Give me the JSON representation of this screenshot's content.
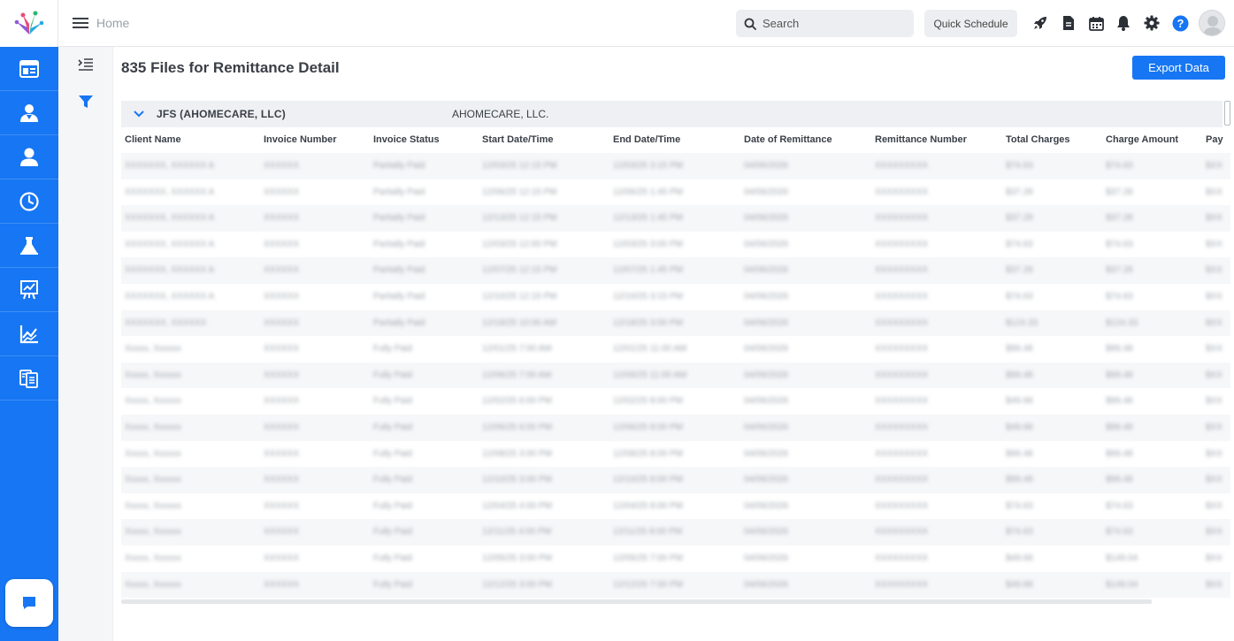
{
  "header": {
    "breadcrumb": "Home",
    "search_placeholder": "Search",
    "quick_schedule_label": "Quick Schedule"
  },
  "page": {
    "title": "835 Files for Remittance Detail",
    "export_label": "Export Data"
  },
  "group": {
    "name": "JFS (AHOMECARE, LLC)",
    "sub": "AHOMECARE, LLC."
  },
  "table": {
    "columns": [
      "Client Name",
      "Invoice Number",
      "Invoice Status",
      "Start Date/Time",
      "End Date/Time",
      "Date of Remittance",
      "Remittance Number",
      "Total Charges",
      "Charge Amount",
      "Pay"
    ],
    "rows": [
      [
        "XXXXXXX, XXXXXX A",
        "XXXXXX",
        "Partially Paid",
        "12/03/25 12:15 PM",
        "12/03/25 3:15 PM",
        "04/06/2026",
        "XXXXXXXXX",
        "$74.63",
        "$74.63",
        "$XX"
      ],
      [
        "XXXXXXX, XXXXXX A",
        "XXXXXX",
        "Partially Paid",
        "12/06/25 12:15 PM",
        "12/06/25 1:45 PM",
        "04/06/2026",
        "XXXXXXXXX",
        "$37.28",
        "$37.28",
        "$XX"
      ],
      [
        "XXXXXXX, XXXXXX A",
        "XXXXXX",
        "Partially Paid",
        "12/13/25 12:15 PM",
        "12/13/25 1:45 PM",
        "04/06/2026",
        "XXXXXXXXX",
        "$37.28",
        "$37.28",
        "$XX"
      ],
      [
        "XXXXXXX, XXXXXX A",
        "XXXXXX",
        "Partially Paid",
        "12/03/25 12:00 PM",
        "12/03/25 3:00 PM",
        "04/06/2026",
        "XXXXXXXXX",
        "$74.63",
        "$74.63",
        "$XX"
      ],
      [
        "XXXXXXX, XXXXXX A",
        "XXXXXX",
        "Partially Paid",
        "12/07/25 12:15 PM",
        "12/07/25 1:45 PM",
        "04/06/2026",
        "XXXXXXXXX",
        "$37.28",
        "$37.28",
        "$XX"
      ],
      [
        "XXXXXXX, XXXXXX A",
        "XXXXXX",
        "Partially Paid",
        "12/10/25 12:15 PM",
        "12/10/25 3:15 PM",
        "04/06/2026",
        "XXXXXXXXX",
        "$74.63",
        "$74.63",
        "$XX"
      ],
      [
        "XXXXXXX, XXXXXX",
        "XXXXXX",
        "Partially Paid",
        "12/18/25 10:00 AM",
        "12/18/25 3:00 PM",
        "04/06/2026",
        "XXXXXXXXX",
        "$124.33",
        "$124.33",
        "$XX"
      ],
      [
        "Xxxxx, Xxxxxx",
        "XXXXXX",
        "Fully Paid",
        "12/01/25 7:00 AM",
        "12/01/25 11:00 AM",
        "04/06/2026",
        "XXXXXXXXX",
        "$99.48",
        "$99.48",
        "$XX"
      ],
      [
        "Xxxxx, Xxxxxx",
        "XXXXXX",
        "Fully Paid",
        "12/06/25 7:00 AM",
        "12/06/25 11:00 AM",
        "04/06/2026",
        "XXXXXXXXX",
        "$99.48",
        "$99.48",
        "$XX"
      ],
      [
        "Xxxxx, Xxxxxx",
        "XXXXXX",
        "Fully Paid",
        "12/02/25 6:00 PM",
        "12/02/25 8:00 PM",
        "04/06/2026",
        "XXXXXXXXX",
        "$49.68",
        "$99.48",
        "$XX"
      ],
      [
        "Xxxxx, Xxxxxx",
        "XXXXXX",
        "Fully Paid",
        "12/06/25 6:00 PM",
        "12/06/25 8:00 PM",
        "04/06/2026",
        "XXXXXXXXX",
        "$49.68",
        "$99.48",
        "$XX"
      ],
      [
        "Xxxxx, Xxxxxx",
        "XXXXXX",
        "Fully Paid",
        "12/08/25 3:00 PM",
        "12/08/25 8:00 PM",
        "04/06/2026",
        "XXXXXXXXX",
        "$99.48",
        "$99.48",
        "$XX"
      ],
      [
        "Xxxxx, Xxxxxx",
        "XXXXXX",
        "Fully Paid",
        "12/10/25 3:00 PM",
        "12/10/25 8:00 PM",
        "04/06/2026",
        "XXXXXXXXX",
        "$99.48",
        "$99.48",
        "$XX"
      ],
      [
        "Xxxxx, Xxxxxx",
        "XXXXXX",
        "Fully Paid",
        "12/04/25 4:00 PM",
        "12/04/25 8:00 PM",
        "04/06/2026",
        "XXXXXXXXX",
        "$74.63",
        "$74.63",
        "$XX"
      ],
      [
        "Xxxxx, Xxxxxx",
        "XXXXXX",
        "Fully Paid",
        "12/11/25 4:00 PM",
        "12/11/25 8:00 PM",
        "04/06/2026",
        "XXXXXXXXX",
        "$74.63",
        "$74.63",
        "$XX"
      ],
      [
        "Xxxxx, Xxxxxx",
        "XXXXXX",
        "Fully Paid",
        "12/05/25 3:00 PM",
        "12/05/25 7:00 PM",
        "04/06/2026",
        "XXXXXXXXX",
        "$49.68",
        "$149.04",
        "$XX"
      ],
      [
        "Xxxxx, Xxxxxx",
        "XXXXXX",
        "Fully Paid",
        "12/12/25 3:00 PM",
        "12/12/25 7:00 PM",
        "04/06/2026",
        "XXXXXXXXX",
        "$49.68",
        "$149.04",
        "$XX"
      ]
    ]
  },
  "icons": {
    "brand_color": "#1676f3",
    "help_color": "#1676f3"
  }
}
